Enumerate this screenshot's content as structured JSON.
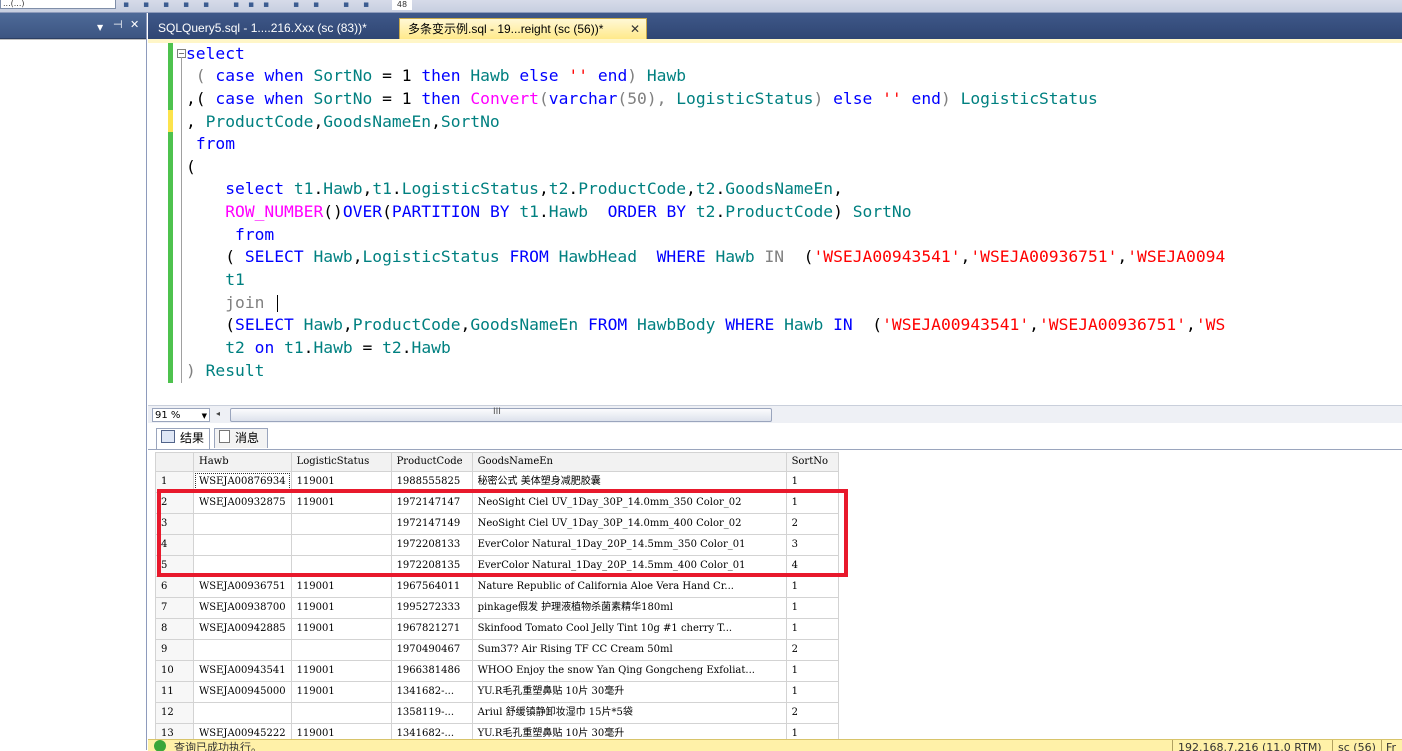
{
  "toolbar": {
    "combo_text": "...(...)",
    "zoom_partial": "48"
  },
  "left_panel": {
    "pin_icon": "pin-icon",
    "close_icon": "close-icon",
    "dropdown_icon": "chevron-down-icon"
  },
  "tabs": [
    {
      "label": "SQLQuery5.sql - 1....216.Xxx (sc (83))*"
    },
    {
      "label": "多条变示例.sql - 19...reight (sc (56))*",
      "close": "✕"
    }
  ],
  "editor": {
    "lines": [
      [
        "select"
      ],
      [
        " ( case when SortNo = 1 then Hawb else '' end) Hawb"
      ],
      [
        ",( case when SortNo = 1 then Convert(varchar(50), LogisticStatus) else '' end) LogisticStatus"
      ],
      [
        ", ProductCode,GoodsNameEn,SortNo"
      ],
      [
        " from"
      ],
      [
        "("
      ],
      [
        "    select t1.Hawb,t1.LogisticStatus,t2.ProductCode,t2.GoodsNameEn,"
      ],
      [
        "    ROW_NUMBER()OVER(PARTITION BY t1.Hawb  ORDER BY t2.ProductCode) SortNo"
      ],
      [
        "     from"
      ],
      [
        "    ( SELECT Hawb,LogisticStatus FROM HawbHead  WHERE Hawb IN  ('WSEJA00943541','WSEJA00936751','WSEJA0094"
      ],
      [
        "    t1"
      ],
      [
        "    join "
      ],
      [
        "    (SELECT Hawb,ProductCode,GoodsNameEn FROM HawbBody WHERE Hawb IN  ('WSEJA00943541','WSEJA00936751','WS"
      ],
      [
        "    t2 on t1.Hawb = t2.Hawb"
      ],
      [
        ") Result"
      ]
    ]
  },
  "zoom": {
    "value": "91 %",
    "grip": "III"
  },
  "results_tabs": {
    "results": "结果",
    "messages": "消息"
  },
  "grid": {
    "columns": [
      "",
      "Hawb",
      "LogisticStatus",
      "ProductCode",
      "GoodsNameEn",
      "SortNo"
    ],
    "rows": [
      [
        "1",
        "WSEJA00876934",
        "119001",
        "1988555825",
        "秘密公式 美体塑身减肥胶囊",
        "1"
      ],
      [
        "2",
        "WSEJA00932875",
        "119001",
        "1972147147",
        "NeoSight Ciel UV_1Day_30P_14.0mm_350 Color_02",
        "1"
      ],
      [
        "3",
        "",
        "",
        "1972147149",
        "NeoSight Ciel UV_1Day_30P_14.0mm_400 Color_02",
        "2"
      ],
      [
        "4",
        "",
        "",
        "1972208133",
        "EverColor Natural_1Day_20P_14.5mm_350 Color_01",
        "3"
      ],
      [
        "5",
        "",
        "",
        "1972208135",
        "EverColor Natural_1Day_20P_14.5mm_400 Color_01",
        "4"
      ],
      [
        "6",
        "WSEJA00936751",
        "119001",
        "1967564011",
        "Nature Republic of California Aloe Vera Hand Cr...",
        "1"
      ],
      [
        "7",
        "WSEJA00938700",
        "119001",
        "1995272333",
        "pinkage假发 护理液植物杀菌素精华180ml",
        "1"
      ],
      [
        "8",
        "WSEJA00942885",
        "119001",
        "1967821271",
        "Skinfood Tomato Cool Jelly Tint 10g #1 cherry T...",
        "1"
      ],
      [
        "9",
        "",
        "",
        "1970490467",
        "Sum37? Air Rising TF CC Cream 50ml",
        "2"
      ],
      [
        "10",
        "WSEJA00943541",
        "119001",
        "1966381486",
        "WHOO Enjoy the snow Yan Qing Gongcheng Exfoliat...",
        "1"
      ],
      [
        "11",
        "WSEJA00945000",
        "119001",
        "1341682-...",
        "YU.R毛孔重塑鼻贴 10片 30毫升",
        "1"
      ],
      [
        "12",
        "",
        "",
        "1358119-...",
        "Ariul 舒缓镇静卸妆湿巾 15片*5袋",
        "2"
      ],
      [
        "13",
        "WSEJA00945222",
        "119001",
        "1341682-...",
        "YU.R毛孔重塑鼻贴 10片 30毫升",
        "1"
      ]
    ]
  },
  "status": {
    "message": "查询已成功执行。",
    "server": "192.168.7.216 (11.0 RTM)",
    "user": "sc (56)",
    "tail": "Fr"
  },
  "colors": {
    "keyword": "#0000ff",
    "function": "#ff00ff",
    "identifier": "#008080",
    "string": "#ff0000",
    "highlight": "#e8192c",
    "status_bg": "#fff1a8"
  }
}
